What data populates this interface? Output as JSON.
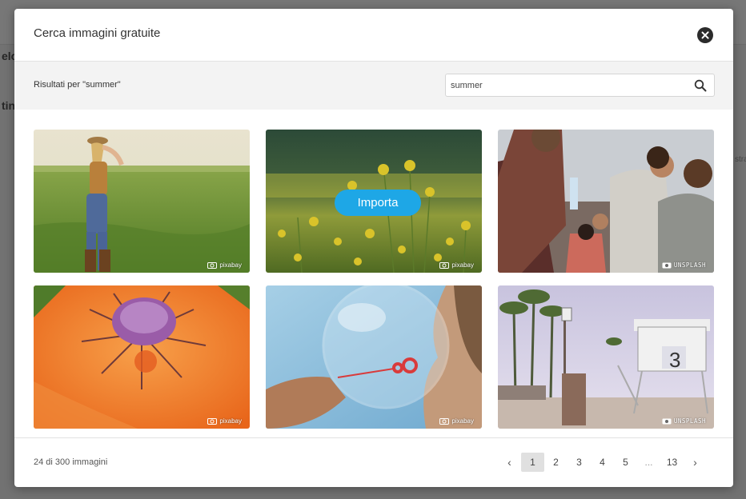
{
  "background": {
    "partial_text_1": "elc",
    "partial_text_2": "tin",
    "partial_text_3": "stra"
  },
  "modal": {
    "title": "Cerca immagini gratuite",
    "close_icon": "close-circle-icon"
  },
  "search": {
    "results_label": "Risultati per \"summer\"",
    "value": "summer",
    "icon": "search-icon"
  },
  "images": [
    {
      "description": "woman in field",
      "provider": "pixabay"
    },
    {
      "description": "yellow flowers",
      "provider": "pixabay",
      "hover_action": "Importa"
    },
    {
      "description": "crowd festival",
      "provider": "UNSPLASH"
    },
    {
      "description": "orange poppy",
      "provider": "pixabay"
    },
    {
      "description": "soap bubble",
      "provider": "pixabay"
    },
    {
      "description": "lifeguard tower",
      "provider": "UNSPLASH"
    }
  ],
  "footer": {
    "count": "24 di 300 immagini",
    "pagination": {
      "prev": "‹",
      "pages": [
        "1",
        "2",
        "3",
        "4",
        "5",
        "...",
        "13"
      ],
      "current": "1",
      "next": "›"
    }
  },
  "colors": {
    "accent": "#1ea7e6",
    "overlay": "#4a4a4a"
  }
}
